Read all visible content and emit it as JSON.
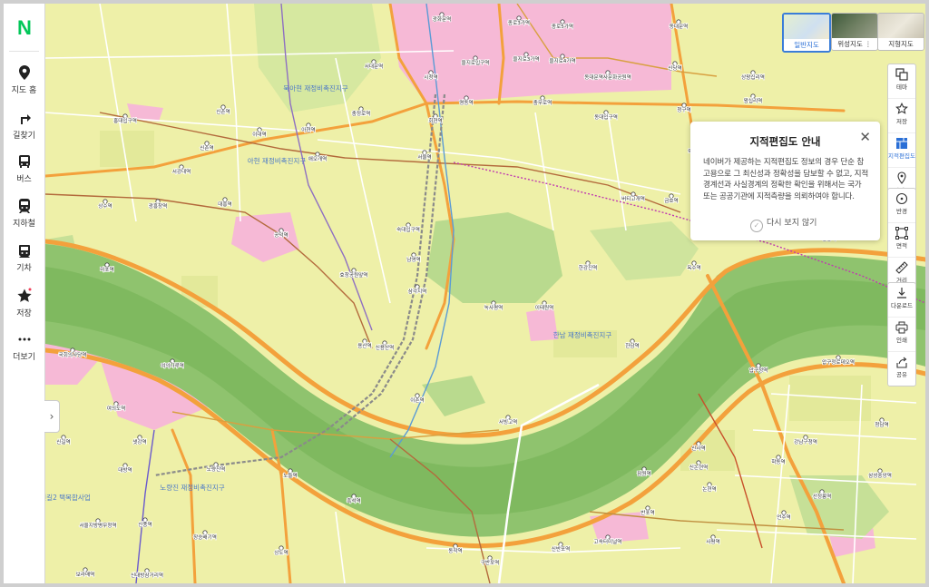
{
  "app": {
    "logo": "N"
  },
  "sidebar": {
    "items": [
      {
        "label": "지도 홈",
        "icon": "location-pin-icon"
      },
      {
        "label": "길찾기",
        "icon": "directions-arrow-icon"
      },
      {
        "label": "버스",
        "icon": "bus-icon"
      },
      {
        "label": "지하철",
        "icon": "subway-icon"
      },
      {
        "label": "기차",
        "icon": "train-icon"
      },
      {
        "label": "저장",
        "icon": "star-icon"
      },
      {
        "label": "더보기",
        "icon": "more-dots-icon"
      }
    ],
    "collapse_glyph": "›"
  },
  "map_types": [
    {
      "label": "일반지도",
      "active": true
    },
    {
      "label": "위성지도 ⋮",
      "active": false
    },
    {
      "label": "지형지도",
      "active": false
    }
  ],
  "toolbar": [
    {
      "label": "테마",
      "icon": "layers-icon"
    },
    {
      "label": "저장",
      "icon": "star-outline-icon"
    },
    {
      "label": "지적편집도",
      "icon": "cadastral-map-icon",
      "active": true
    },
    {
      "label": "거리뷰",
      "icon": "street-view-icon"
    },
    {
      "label": "반경",
      "icon": "radius-icon"
    },
    {
      "label": "면적",
      "icon": "area-icon"
    },
    {
      "label": "거리",
      "icon": "ruler-icon"
    },
    {
      "label": "다운로드",
      "icon": "download-icon"
    },
    {
      "label": "인쇄",
      "icon": "print-icon"
    },
    {
      "label": "공유",
      "icon": "share-icon"
    }
  ],
  "popup": {
    "title": "지적편집도 안내",
    "body": "네이버가 제공하는 지적편집도 정보의 경우 단순 참고용으로 그 최신성과 정확성을 담보할 수 없고, 지적 경계선과 사실경계의 정확한 확인을 위해서는 국가 또는 공공기관에 지적측량을 의뢰하여야 합니다.",
    "dont_show": "다시 보지 않기",
    "close_glyph": "✕"
  },
  "map": {
    "colors": {
      "base": "#eef0a8",
      "residential": "#e8ec9e",
      "commercial": "#f6b9d6",
      "green": "#b9da8e",
      "park": "#a8d07f",
      "river": "#8fc36e",
      "road_major": "#f3a13c",
      "road_minor": "#ffffff",
      "rail": "#8a8a8a"
    },
    "district_labels": [
      "북아현 재정비촉진지구",
      "아현 재정비촉진지구",
      "한남 재정비촉진지구",
      "노량진 재정비촉진지구",
      "신길2 택복합사업"
    ],
    "stations": [
      "광화문역",
      "종로3가역",
      "종로5가역",
      "동대문역",
      "을지로입구역",
      "을지로3가역",
      "을지로4가역",
      "동대문역사문화공원역",
      "신당역",
      "상왕십리역",
      "왕십리역",
      "서대문역",
      "시청역",
      "충정로역",
      "명동역",
      "충무로역",
      "동대입구역",
      "약수역",
      "청구역",
      "신촌역",
      "이대역",
      "아현역",
      "애오개역",
      "회현역",
      "서울역",
      "버티고개역",
      "금호역",
      "응봉역",
      "홍대입구역",
      "신촌역",
      "서강대역",
      "대흥역",
      "공덕역",
      "숙대입구역",
      "효창공원앞역",
      "남영역",
      "광흥창역",
      "상수역",
      "마포역",
      "용산역",
      "신용산역",
      "삼각지역",
      "녹사평역",
      "이태원역",
      "한강진역",
      "옥수역",
      "압구정역",
      "한남역",
      "여의나루역",
      "여의도역",
      "국회의사당역",
      "이촌역",
      "서빙고역",
      "신길역",
      "노량진역",
      "샛강역",
      "대방역",
      "노들역",
      "흑석역",
      "신사역",
      "잠원역",
      "논현역",
      "반포역",
      "신논현역",
      "학동역",
      "강남구청역",
      "압구정로데오역",
      "청담역",
      "삼성중앙역",
      "선정릉역",
      "언주역",
      "사평역",
      "고속터미널역",
      "신반포역",
      "구반포역",
      "동작역",
      "상도역",
      "장승배기역",
      "보라매역",
      "신대방삼거리역",
      "서울지방병무청역",
      "신풍역"
    ]
  }
}
